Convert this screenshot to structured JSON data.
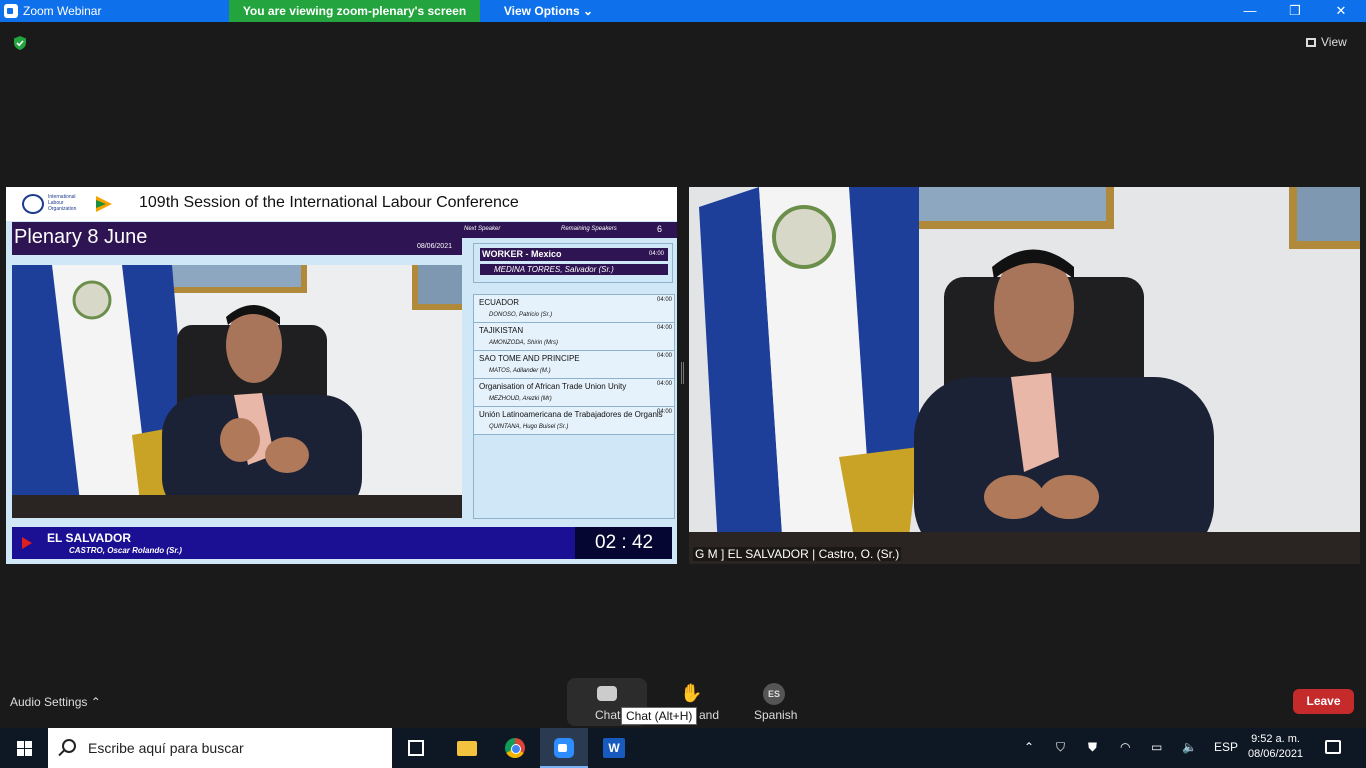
{
  "window": {
    "title": "Zoom Webinar",
    "share_banner": "You are viewing zoom-plenary's screen",
    "view_options": "View Options",
    "minimize": "—",
    "restore": "❐",
    "close": "✕"
  },
  "meeting": {
    "view_label": "View"
  },
  "shared_screen": {
    "org_name": "International Labour Organization",
    "conference_title": "109th Session of the International Labour Conference",
    "plenary_title": "Plenary 8 June",
    "plenary_date": "08/06/2021",
    "next_speaker_label": "Next Speaker",
    "remaining_label": "Remaining Speakers",
    "remaining_count": "6",
    "next_speaker": {
      "group": "WORKER  -  Mexico",
      "time": "04:00",
      "name": "MEDINA TORRES, Salvador (Sr.)"
    },
    "speakers": [
      {
        "country": "ECUADOR",
        "name": "DONOSO, Patricio (Sr.)",
        "time": "04:00"
      },
      {
        "country": "TAJIKISTAN",
        "name": "AMONZODA, Shirin (Mrs)",
        "time": "04:00"
      },
      {
        "country": "SAO TOME AND PRINCIPE",
        "name": "MATOS, Adilander (M.)",
        "time": "04:00"
      },
      {
        "country": "Organisation of African Trade Union Unity",
        "name": "MEZHOUD, Arezki (Mr)",
        "time": "04:00"
      },
      {
        "country": "Unión Latinoamericana de Trabajadores de Organis",
        "name": "QUINTANA, Hugo Buisel (Sr.)",
        "time": "04:00"
      }
    ],
    "current_country": "EL SALVADOR",
    "current_name": "CASTRO, Oscar Rolando (Sr.)",
    "timer": "02 : 42"
  },
  "video": {
    "participant_label": "G M ] EL SALVADOR | Castro, O. (Sr.)"
  },
  "toolbar": {
    "audio_settings": "Audio Settings",
    "chat_label": "Chat",
    "chat_tooltip": "Chat (Alt+H)",
    "raise_hand_label": "and",
    "language_badge": "ES",
    "language_label": "Spanish",
    "leave_label": "Leave"
  },
  "taskbar": {
    "search_placeholder": "Escribe aquí para buscar",
    "word_letter": "W",
    "language": "ESP",
    "time": "9:52 a. m.",
    "date": "08/06/2021"
  },
  "colors": {
    "zoom_blue": "#0e71eb",
    "share_green": "#23a43e",
    "leave_red": "#c52b2b",
    "plenary_purple": "#2e1452",
    "footer_blue": "#1b0f94"
  }
}
